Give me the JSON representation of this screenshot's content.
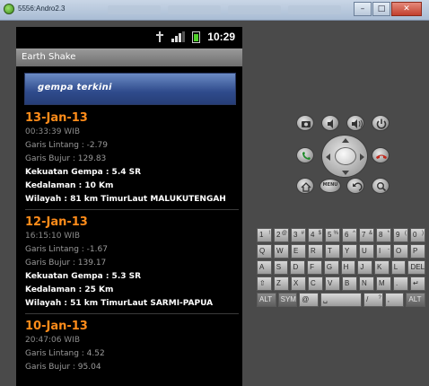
{
  "window": {
    "title": "5556:Andro2.3",
    "buttons": {
      "minimize": "–",
      "maximize": "□",
      "close": "✕"
    }
  },
  "status_bar": {
    "time": "10:29"
  },
  "app": {
    "title": "Earth Shake",
    "banner": "gempa terkini"
  },
  "quakes": [
    {
      "date": "13-Jan-13",
      "time": "00:33:39 WIB",
      "lintang": "Garis Lintang : -2.79",
      "bujur": "Garis Bujur : 129.83",
      "kekuatan": "Kekuatan Gempa : 5.4 SR",
      "kedalaman": "Kedalaman : 10 Km",
      "wilayah": "Wilayah : 81 km TimurLaut MALUKUTENGAH"
    },
    {
      "date": "12-Jan-13",
      "time": "16:15:10 WIB",
      "lintang": "Garis Lintang : -1.67",
      "bujur": "Garis Bujur : 139.17",
      "kekuatan": "Kekuatan Gempa : 5.3 SR",
      "kedalaman": "Kedalaman : 25 Km",
      "wilayah": "Wilayah : 51 km TimurLaut SARMI-PAPUA"
    },
    {
      "date": "10-Jan-13",
      "time": "20:47:06 WIB",
      "lintang": "Garis Lintang : 4.52",
      "bujur": "Garis Bujur : 95.04"
    }
  ],
  "controls": {
    "menu_label": "MENU",
    "icons": [
      "camera-icon",
      "volume-down-icon",
      "volume-up-icon",
      "power-icon",
      "call-icon",
      "end-call-icon",
      "home-icon",
      "back-icon",
      "search-icon"
    ]
  },
  "keyboard": {
    "row1": [
      {
        "k": "1",
        "s": "!"
      },
      {
        "k": "2",
        "s": "@"
      },
      {
        "k": "3",
        "s": "#"
      },
      {
        "k": "4",
        "s": "$"
      },
      {
        "k": "5",
        "s": "%"
      },
      {
        "k": "6",
        "s": "^"
      },
      {
        "k": "7",
        "s": "&"
      },
      {
        "k": "8",
        "s": "*"
      },
      {
        "k": "9",
        "s": "("
      },
      {
        "k": "0",
        "s": ")"
      }
    ],
    "row2": [
      {
        "k": "Q",
        "s": ""
      },
      {
        "k": "W",
        "s": ""
      },
      {
        "k": "E",
        "s": ""
      },
      {
        "k": "R",
        "s": ""
      },
      {
        "k": "T",
        "s": ""
      },
      {
        "k": "Y",
        "s": ""
      },
      {
        "k": "U",
        "s": ""
      },
      {
        "k": "I",
        "s": "-"
      },
      {
        "k": "O",
        "s": ""
      },
      {
        "k": "P",
        "s": ""
      }
    ],
    "row3": [
      {
        "k": "A",
        "s": ""
      },
      {
        "k": "S",
        "s": ""
      },
      {
        "k": "D",
        "s": ""
      },
      {
        "k": "F",
        "s": ""
      },
      {
        "k": "G",
        "s": ""
      },
      {
        "k": "H",
        "s": ""
      },
      {
        "k": "J",
        "s": ""
      },
      {
        "k": "K",
        "s": ""
      },
      {
        "k": "L",
        "s": ""
      },
      {
        "k": "DEL",
        "s": ""
      }
    ],
    "row4": [
      {
        "k": "⇧",
        "s": ""
      },
      {
        "k": "Z",
        "s": ""
      },
      {
        "k": "X",
        "s": ""
      },
      {
        "k": "C",
        "s": ""
      },
      {
        "k": "V",
        "s": ""
      },
      {
        "k": "B",
        "s": ""
      },
      {
        "k": "N",
        "s": ""
      },
      {
        "k": "M",
        "s": ""
      },
      {
        "k": ".",
        "s": ""
      },
      {
        "k": "↵",
        "s": ""
      }
    ],
    "row5": [
      {
        "k": "ALT",
        "s": ""
      },
      {
        "k": "SYM",
        "s": ""
      },
      {
        "k": "@",
        "s": ""
      },
      {
        "k": "␣",
        "s": ""
      },
      {
        "k": "/",
        "s": "?"
      },
      {
        "k": ",",
        "s": ""
      },
      {
        "k": "ALT",
        "s": ""
      }
    ]
  }
}
